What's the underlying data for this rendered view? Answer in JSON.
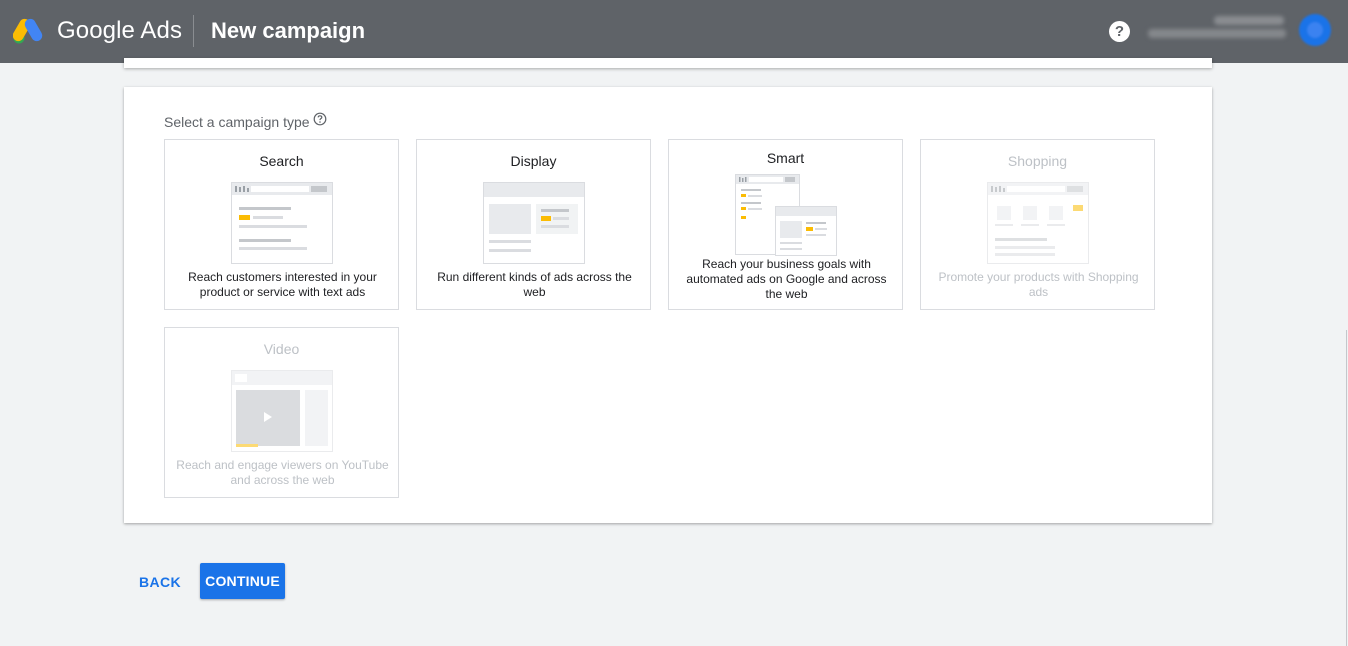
{
  "header": {
    "product_name": "Google Ads",
    "page_title": "New campaign",
    "help_icon": "help-circle-icon",
    "help_glyph": "?"
  },
  "colors": {
    "topbar": "#5f6368",
    "accent": "#1a73e8",
    "page_background": "#f1f3f4",
    "highlight_yellow": "#fbbc04"
  },
  "selection": {
    "label": "Select a campaign type",
    "info_icon": "question-circle-icon"
  },
  "campaign_types": [
    {
      "id": "search",
      "title": "Search",
      "description": "Reach customers interested in your product or service with text ads",
      "enabled": true,
      "icon": "search-ad-illustration"
    },
    {
      "id": "display",
      "title": "Display",
      "description": "Run different kinds of ads across the web",
      "enabled": true,
      "icon": "display-ad-illustration"
    },
    {
      "id": "smart",
      "title": "Smart",
      "description": "Reach your business goals with automated ads on Google and across the web",
      "enabled": true,
      "icon": "smart-campaign-illustration"
    },
    {
      "id": "shopping",
      "title": "Shopping",
      "description": "Promote your products with Shopping ads",
      "enabled": false,
      "icon": "shopping-ad-illustration"
    },
    {
      "id": "video",
      "title": "Video",
      "description": "Reach and engage viewers on YouTube and across the web",
      "enabled": false,
      "icon": "video-ad-illustration"
    }
  ],
  "actions": {
    "back_label": "BACK",
    "continue_label": "CONTINUE"
  }
}
